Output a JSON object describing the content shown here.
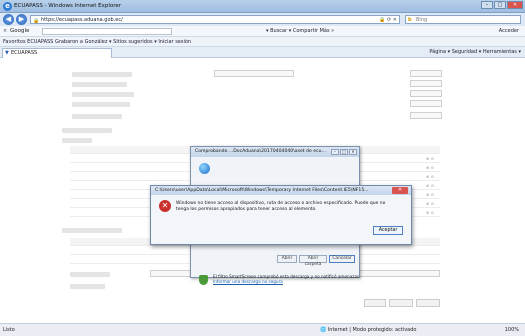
{
  "window": {
    "title": "ECUAPASS - Windows Internet Explorer",
    "controls": [
      "–",
      "□",
      "✕"
    ]
  },
  "address_bar": {
    "url": "https://ecuapass.aduana.gob.ec/",
    "search_engine": "Bing",
    "search_placeholder": "Bing"
  },
  "google_toolbar": {
    "label": "Google",
    "tools": "▾ Buscar ▾  Compartir  Más »",
    "sign_in": "Acceder"
  },
  "favorites_bar": {
    "text": "Favoritos   ECUAPASS   Grabaron a González ▾   Sitios sugeridos ▾   Iniciar sesión"
  },
  "tab": {
    "label": "ECUAPASS"
  },
  "command_bar": {
    "text": "Página ▾  Seguridad ▾  Herramientas ▾"
  },
  "download_dialog": {
    "title": "Comprobando ...DocAduana\\20170404040\\aset de ecu...",
    "buttons": [
      "Abrir",
      "Abrir carpeta",
      "Cancelar"
    ],
    "smartscreen_text": "El filtro SmartScreen comprobó esta descarga y no notificó amenazas.",
    "smartscreen_link": "Informar una descarga no segura"
  },
  "error_dialog": {
    "title": "C:\\Users\\user\\AppData\\Local\\Microsoft\\Windows\\Temporary Internet Files\\Content.IE5\\NF15...",
    "message_line1": "Windows no tiene acceso al dispositivo, ruta de acceso o archivo especificado. Puede que no",
    "message_line2": "tenga los permisos apropiados para tener acceso al elemento.",
    "ok_label": "Aceptar"
  },
  "status_bar": {
    "left": "Listo",
    "zone": "Internet | Modo protegido: activado",
    "zoom": "100%"
  }
}
